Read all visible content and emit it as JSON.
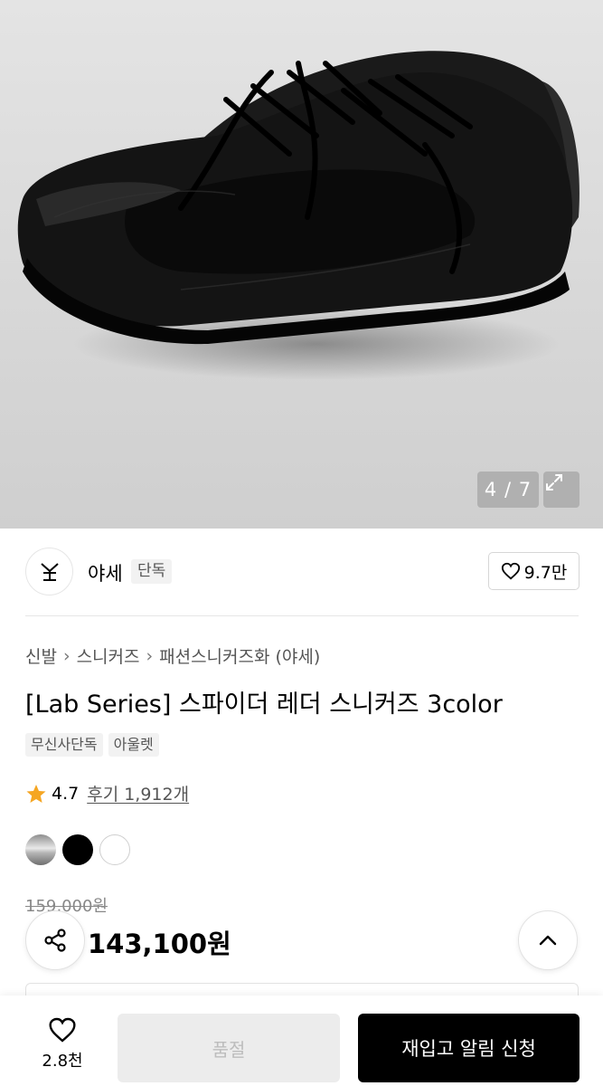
{
  "gallery": {
    "counter": "4 / 7"
  },
  "brand": {
    "name": "야세",
    "tag": "단독",
    "like_count": "9.7만"
  },
  "breadcrumb": [
    "신발",
    "스니커즈",
    "패션스니커즈화 (야세)"
  ],
  "product": {
    "title": "[Lab Series] 스파이더 레더 스니커즈 3color",
    "tags": [
      "무신사단독",
      "아울렛"
    ],
    "rating": "4.7",
    "reviews": "후기 1,912개",
    "colors": [
      "silver",
      "black",
      "white"
    ],
    "original_price": "159,000원",
    "price": "143,100원"
  },
  "bottom_bar": {
    "wish_count": "2.8천",
    "soldout_label": "품절",
    "restock_label": "재입고 알림 신청"
  },
  "icons": [
    "expand-icon",
    "brand-logo-icon",
    "heart-icon",
    "star-icon",
    "share-icon",
    "chevron-up-icon"
  ],
  "colors": {
    "star": "#f5a623",
    "primary_button": "#000000",
    "disabled_button": "#ececec"
  }
}
